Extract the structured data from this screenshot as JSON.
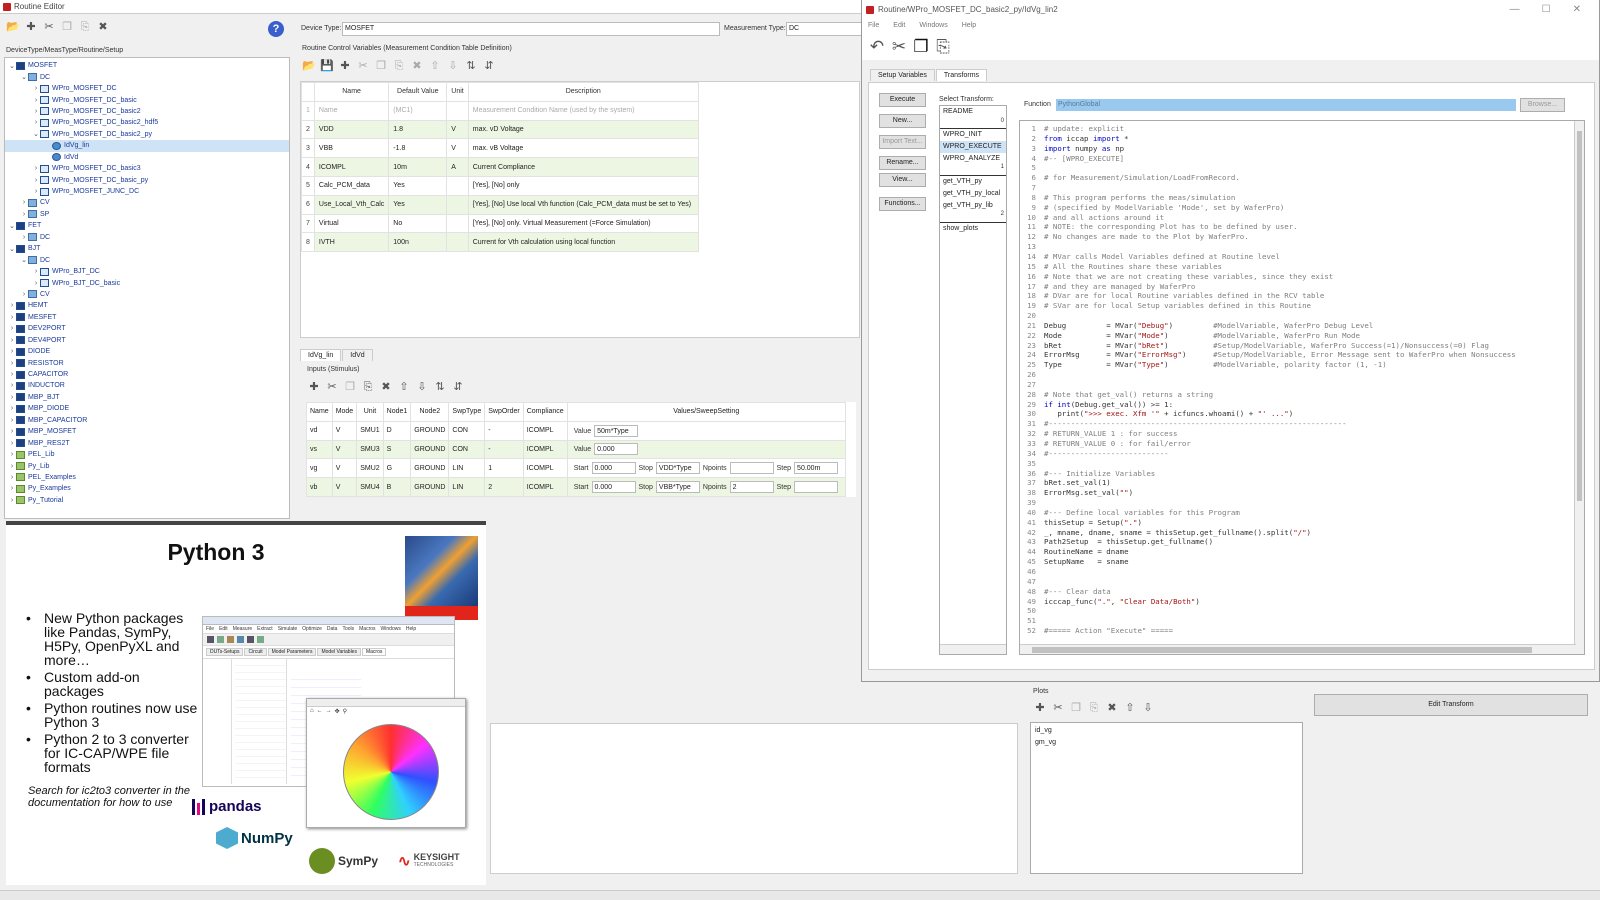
{
  "main_title": "Routine Editor",
  "tree_header": "DeviceType/MeasType/Routine/Setup",
  "tree": [
    {
      "d": 0,
      "e": "v",
      "k": "dark",
      "t": "MOSFET"
    },
    {
      "d": 1,
      "e": "v",
      "k": "fold",
      "t": "DC"
    },
    {
      "d": 2,
      "e": ">",
      "k": "",
      "t": "WPro_MOSFET_DC"
    },
    {
      "d": 2,
      "e": ">",
      "k": "",
      "t": "WPro_MOSFET_DC_basic"
    },
    {
      "d": 2,
      "e": ">",
      "k": "",
      "t": "WPro_MOSFET_DC_basic2"
    },
    {
      "d": 2,
      "e": ">",
      "k": "",
      "t": "WPro_MOSFET_DC_basic2_hdf5"
    },
    {
      "d": 2,
      "e": "v",
      "k": "",
      "t": "WPro_MOSFET_DC_basic2_py"
    },
    {
      "d": 3,
      "e": "",
      "k": "gear",
      "t": "IdVg_lin",
      "s": true
    },
    {
      "d": 3,
      "e": "",
      "k": "gear",
      "t": "IdVd"
    },
    {
      "d": 2,
      "e": ">",
      "k": "",
      "t": "WPro_MOSFET_DC_basic3"
    },
    {
      "d": 2,
      "e": ">",
      "k": "",
      "t": "WPro_MOSFET_DC_basic_py"
    },
    {
      "d": 2,
      "e": ">",
      "k": "",
      "t": "WPro_MOSFET_JUNC_DC"
    },
    {
      "d": 1,
      "e": ">",
      "k": "fold",
      "t": "CV"
    },
    {
      "d": 1,
      "e": ">",
      "k": "fold",
      "t": "SP"
    },
    {
      "d": 0,
      "e": "v",
      "k": "dark",
      "t": "FET"
    },
    {
      "d": 1,
      "e": ">",
      "k": "fold",
      "t": "DC"
    },
    {
      "d": 0,
      "e": "v",
      "k": "dark",
      "t": "BJT"
    },
    {
      "d": 1,
      "e": "v",
      "k": "fold",
      "t": "DC"
    },
    {
      "d": 2,
      "e": ">",
      "k": "",
      "t": "WPro_BJT_DC"
    },
    {
      "d": 2,
      "e": ">",
      "k": "",
      "t": "WPro_BJT_DC_basic"
    },
    {
      "d": 1,
      "e": ">",
      "k": "fold",
      "t": "CV"
    },
    {
      "d": 0,
      "e": ">",
      "k": "dark",
      "t": "HEMT"
    },
    {
      "d": 0,
      "e": ">",
      "k": "dark",
      "t": "MESFET"
    },
    {
      "d": 0,
      "e": ">",
      "k": "dark",
      "t": "DEV2PORT"
    },
    {
      "d": 0,
      "e": ">",
      "k": "dark",
      "t": "DEV4PORT"
    },
    {
      "d": 0,
      "e": ">",
      "k": "dark",
      "t": "DIODE"
    },
    {
      "d": 0,
      "e": ">",
      "k": "dark",
      "t": "RESISTOR"
    },
    {
      "d": 0,
      "e": ">",
      "k": "dark",
      "t": "CAPACITOR"
    },
    {
      "d": 0,
      "e": ">",
      "k": "dark",
      "t": "INDUCTOR"
    },
    {
      "d": 0,
      "e": ">",
      "k": "dark",
      "t": "MBP_BJT"
    },
    {
      "d": 0,
      "e": ">",
      "k": "dark",
      "t": "MBP_DIODE"
    },
    {
      "d": 0,
      "e": ">",
      "k": "dark",
      "t": "MBP_CAPACITOR"
    },
    {
      "d": 0,
      "e": ">",
      "k": "dark",
      "t": "MBP_MOSFET"
    },
    {
      "d": 0,
      "e": ">",
      "k": "dark",
      "t": "MBP_RES2T"
    },
    {
      "d": 0,
      "e": ">",
      "k": "lib",
      "t": "PEL_Lib"
    },
    {
      "d": 0,
      "e": ">",
      "k": "lib",
      "t": "Py_Lib"
    },
    {
      "d": 0,
      "e": ">",
      "k": "lib",
      "t": "PEL_Examples"
    },
    {
      "d": 0,
      "e": ">",
      "k": "lib",
      "t": "Py_Examples"
    },
    {
      "d": 0,
      "e": ">",
      "k": "lib",
      "t": "Py_Tutorial"
    }
  ],
  "device_type_label": "Device Type:",
  "device_type": "MOSFET",
  "meas_type_label": "Measurement Type:",
  "meas_type": "DC",
  "rcv_title": "Routine Control Variables (Measurement Condition Table Definition)",
  "rcv_headers": [
    "Name",
    "Default Value",
    "Unit",
    "Description"
  ],
  "rcv_rows": [
    {
      "n": "1",
      "name": "Name",
      "val": "(MC1)",
      "unit": "",
      "desc": "Measurement Condition Name (used by the system)",
      "cls": "dim"
    },
    {
      "n": "2",
      "name": "VDD",
      "val": "1.8",
      "unit": "V",
      "desc": "max. vD Voltage",
      "cls": "hl"
    },
    {
      "n": "3",
      "name": "VBB",
      "val": "-1.8",
      "unit": "V",
      "desc": "max. vB Voltage",
      "cls": ""
    },
    {
      "n": "4",
      "name": "ICOMPL",
      "val": "10m",
      "unit": "A",
      "desc": "Current Compliance",
      "cls": "hl"
    },
    {
      "n": "5",
      "name": "Calc_PCM_data",
      "val": "Yes",
      "unit": "",
      "desc": "[Yes], [No] only",
      "cls": ""
    },
    {
      "n": "6",
      "name": "Use_Local_Vth_Calc",
      "val": "Yes",
      "unit": "",
      "desc": "[Yes], [No] Use local Vth function (Calc_PCM_data must be set to Yes)",
      "cls": "hl"
    },
    {
      "n": "7",
      "name": "Virtual",
      "val": "No",
      "unit": "",
      "desc": "[Yes], [No] only. Virtual Measurement (=Force Simulation)",
      "cls": ""
    },
    {
      "n": "8",
      "name": "IVTH",
      "val": "100n",
      "unit": "",
      "desc": "Current for Vth calculation using local function",
      "cls": "hl"
    }
  ],
  "setup_tabs": [
    "IdVg_lin",
    "IdVd"
  ],
  "inputs_title": "Inputs (Stimulus)",
  "inp_headers": [
    "Name",
    "Mode",
    "Unit",
    "Node1",
    "Node2",
    "SwpType",
    "SwpOrder",
    "Compliance",
    "Values/SweepSetting"
  ],
  "inp_rows": [
    {
      "name": "vd",
      "mode": "V",
      "unit": "SMU1",
      "n1": "D",
      "n2": "GROUND",
      "swp": "CON",
      "ord": "-",
      "comp": "ICOMPL",
      "kind": "value",
      "value": "50m*Type",
      "cls": ""
    },
    {
      "name": "vs",
      "mode": "V",
      "unit": "SMU3",
      "n1": "S",
      "n2": "GROUND",
      "swp": "CON",
      "ord": "-",
      "comp": "ICOMPL",
      "kind": "value",
      "value": "0.000",
      "cls": "hl"
    },
    {
      "name": "vg",
      "mode": "V",
      "unit": "SMU2",
      "n1": "G",
      "n2": "GROUND",
      "swp": "LIN",
      "ord": "1",
      "comp": "ICOMPL",
      "kind": "sweep",
      "start": "0.000",
      "stop": "VDD*Type",
      "npts": "",
      "step": "50.00m",
      "cls": ""
    },
    {
      "name": "vb",
      "mode": "V",
      "unit": "SMU4",
      "n1": "B",
      "n2": "GROUND",
      "swp": "LIN",
      "ord": "2",
      "comp": "ICOMPL",
      "kind": "sweep",
      "start": "0.000",
      "stop": "VBB*Type",
      "npts": "2",
      "step": "",
      "cls": "hl"
    }
  ],
  "field_labels": {
    "value": "Value",
    "start": "Start",
    "stop": "Stop",
    "npoints": "Npoints",
    "step": "Step"
  },
  "tr_title": "Routine/WPro_MOSFET_DC_basic2_py/IdVg_lin2",
  "tr_menu": [
    "File",
    "Edit",
    "Windows",
    "Help"
  ],
  "tr_tabs": [
    "Setup Variables",
    "Transforms"
  ],
  "tr_buttons": [
    "Execute",
    "New...",
    "Import Text...",
    "Rename...",
    "View...",
    "Functions..."
  ],
  "select_transform_label": "Select Transform:",
  "transforms": [
    {
      "t": "README",
      "g": ""
    },
    {
      "t": "",
      "g": "0"
    },
    {
      "t": "WPRO_INIT",
      "g": ""
    },
    {
      "t": "WPRO_EXECUTE",
      "g": "",
      "s": true
    },
    {
      "t": "WPRO_ANALYZE",
      "g": ""
    },
    {
      "t": "",
      "g": "1"
    },
    {
      "t": "get_VTH_py",
      "g": ""
    },
    {
      "t": "get_VTH_py_local",
      "g": ""
    },
    {
      "t": "get_VTH_py_lib",
      "g": ""
    },
    {
      "t": "",
      "g": "2"
    },
    {
      "t": "show_plots",
      "g": ""
    }
  ],
  "function_label": "Function",
  "function_value": "PythonGlobal",
  "browse_label": "Browse...",
  "code_lines": [
    "# update: explicit",
    "from iccap import *",
    "import numpy as np",
    "#-- [WPRO_EXECUTE]",
    "",
    "# for Measurement/Simulation/LoadFromRecord.",
    "",
    "# This program performs the meas/simulation",
    "# (specified by ModelVariable 'Mode', set by WaferPro)",
    "# and all actions around it",
    "# NOTE: the corresponding Plot has to be defined by user.",
    "# No changes are made to the Plot by WaferPro.",
    "",
    "# MVar calls Model Variables defined at Routine level",
    "# All the Routines share these variables",
    "# Note that we are not creating these variables, since they exist",
    "# and they are managed by WaferPro",
    "# DVar are for local Routine variables defined in the RCV table",
    "# SVar are for local Setup variables defined in this Routine",
    "",
    "Debug         = MVar(\"Debug\")         #ModelVariable, WaferPro Debug Level",
    "Mode          = MVar(\"Mode\")          #ModelVariable, WaferPro Run Mode",
    "bRet          = MVar(\"bRet\")          #Setup/ModelVariable, WaferPro Success(=1)/Nonsuccess(=0) Flag",
    "ErrorMsg      = MVar(\"ErrorMsg\")      #Setup/ModelVariable, Error Message sent to WaferPro when Nonsuccess",
    "Type          = MVar(\"Type\")          #ModelVariable, polarity factor (1, -1)",
    "",
    "",
    "# Note that get_val() returns a string",
    "if int(Debug.get_val()) >= 1:",
    "   print(\">>> exec. Xfm '\" + icfuncs.whoami() + \"' ...\")",
    "#-------------------------------------------------------------------",
    "# RETURN_VALUE 1 : for success",
    "# RETURN_VALUE 0 : for fail/error",
    "#---------------------------",
    "",
    "#--- Initialize Variables",
    "bRet.set_val(1)",
    "ErrorMsg.set_val(\"\")",
    "",
    "#--- Define local variables for this Program",
    "thisSetup = Setup(\".\")",
    "_, mname, dname, sname = thisSetup.get_fullname().split(\"/\")",
    "Path2Setup  = thisSetup.get_fullname()",
    "RoutineName = dname",
    "SetupName   = sname",
    "",
    "",
    "#--- Clear data",
    "icccap_func(\".\", \"Clear Data/Both\")",
    "",
    "",
    "#===== Action \"Execute\" ====="
  ],
  "plots_label": "Plots",
  "plots": [
    "id_vg",
    "gm_vg"
  ],
  "edit_transform": "Edit Transform",
  "slide": {
    "title": "Python 3",
    "bullets": [
      "New Python packages like Pandas, SymPy, H5Py, OpenPyXL and more…",
      "Custom add-on packages",
      "Python routines now use Python 3",
      "Python 2 to 3 converter for IC-CAP/WPE file formats"
    ],
    "note": "Search for ic2to3 converter in the documentation for how to use",
    "logos": {
      "pandas": "pandas",
      "numpy": "NumPy",
      "sympy": "SymPy",
      "keysight": "KEYSIGHT",
      "keysight_sub": "TECHNOLOGIES"
    },
    "mini_menu": [
      "File",
      "Edit",
      "Measure",
      "Extract",
      "Simulate",
      "Optimize",
      "Data",
      "Tools",
      "Macros",
      "Windows",
      "Help"
    ],
    "mini_tabs": [
      "DUTs-Setups",
      "Circuit",
      "Model Parameters",
      "Model Variables",
      "Macros"
    ]
  },
  "colors": {
    "accent": "#2a5aa0",
    "row_highlight": "#ecf6e3",
    "selection": "#cfe3f7",
    "keysight_red": "#e1251b",
    "help": "#3a5fcd"
  }
}
